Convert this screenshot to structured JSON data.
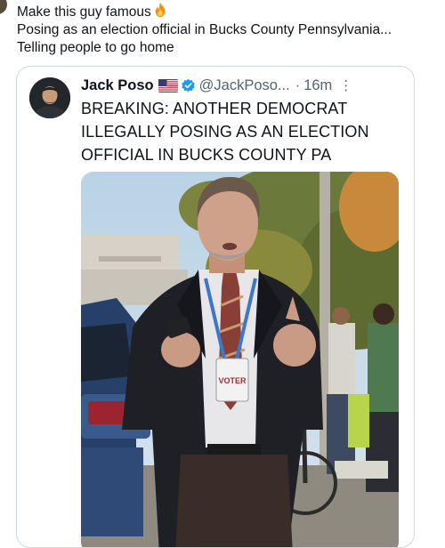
{
  "post": {
    "text_line1": "Make this guy famous",
    "text_line2": "Posing as an election official in Bucks County Pennsylvania...",
    "text_line3": "Telling people to go home",
    "emoji": "fire-icon"
  },
  "quoted_post": {
    "author_name": "Jack Poso",
    "flag": "us-flag-icon",
    "verified": "verified-badge-icon",
    "handle": "@JackPoso...",
    "separator": "·",
    "time": "16m",
    "more": "⋮",
    "text_line1": "BREAKING: ANOTHER DEMOCRAT",
    "text_line2": "ILLEGALLY POSING AS AN ELECTION",
    "text_line3": "OFFICIAL IN BUCKS COUNTY PA",
    "media": {
      "badge_text": "VOTER"
    }
  },
  "colors": {
    "verified_blue": "#1d9bf0",
    "secondary_text": "#536471",
    "border": "#cfd9de"
  }
}
